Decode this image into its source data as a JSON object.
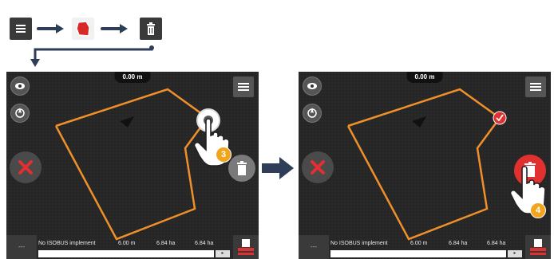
{
  "screens": [
    {
      "speed": "0.00 m",
      "status": {
        "implement": "No ISOBUS implement",
        "width": "6.00 m",
        "area1": "6.84 ha",
        "area2": "6.84 ha",
        "left": "---"
      }
    },
    {
      "speed": "0.00 m",
      "status": {
        "implement": "No ISOBUS implement",
        "width": "6.00 m",
        "area1": "6.84 ha",
        "area2": "6.84 ha",
        "left": "---"
      }
    }
  ],
  "steps": {
    "first": "3",
    "second": "4"
  },
  "colors": {
    "boundary": "#f0902a",
    "accent_red": "#e03030",
    "step_orange": "#f2a41c",
    "arrow_navy": "#2e3d58"
  },
  "icons": [
    "menu-icon",
    "field-boundary-icon",
    "trash-icon",
    "eye-icon",
    "compass-icon",
    "close-icon",
    "checkmark-icon",
    "hand-pointer-icon"
  ]
}
